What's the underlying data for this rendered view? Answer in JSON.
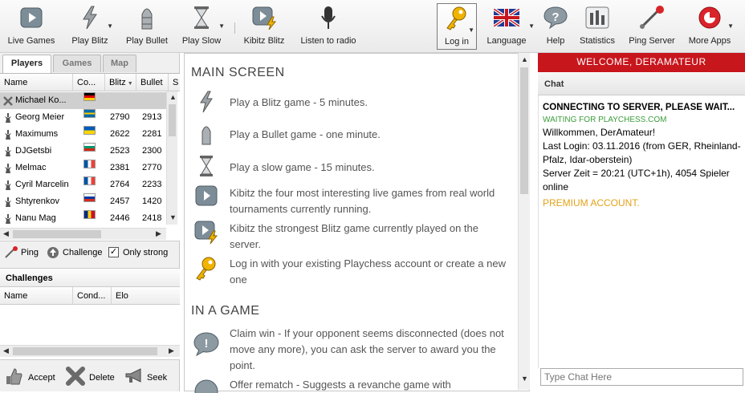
{
  "toolbar": {
    "live_games": "Live Games",
    "play_blitz": "Play Blitz",
    "play_bullet": "Play Bullet",
    "play_slow": "Play Slow",
    "kibitz_blitz": "Kibitz Blitz",
    "listen_radio": "Listen to radio",
    "log_in": "Log in",
    "language": "Language",
    "help": "Help",
    "statistics": "Statistics",
    "ping_server": "Ping Server",
    "more_apps": "More Apps"
  },
  "tabs": {
    "players": "Players",
    "games": "Games",
    "map": "Map"
  },
  "players_table": {
    "columns": [
      "Name",
      "Co...",
      "Blitz",
      "Bullet",
      "S"
    ],
    "rows": [
      {
        "name": "Michael Ko...",
        "flag": "de",
        "blitz": "",
        "bullet": ""
      },
      {
        "name": "Georg Meier",
        "flag": "se",
        "blitz": "2790",
        "bullet": "2913"
      },
      {
        "name": "Maximums",
        "flag": "ua",
        "blitz": "2622",
        "bullet": "2281"
      },
      {
        "name": "DJGetsbi",
        "flag": "bg",
        "blitz": "2523",
        "bullet": "2300"
      },
      {
        "name": "Melmac",
        "flag": "fr",
        "blitz": "2381",
        "bullet": "2770"
      },
      {
        "name": "Cyril Marcelin",
        "flag": "fr",
        "blitz": "2764",
        "bullet": "2233"
      },
      {
        "name": "Shtyrenkov",
        "flag": "ru",
        "blitz": "2457",
        "bullet": "1420"
      },
      {
        "name": "Nanu Mag",
        "flag": "ro",
        "blitz": "2446",
        "bullet": "2418"
      }
    ]
  },
  "player_actions": {
    "ping": "Ping",
    "challenge": "Challenge",
    "only_strong": "Only strong"
  },
  "challenges": {
    "title": "Challenges",
    "columns": [
      "Name",
      "Cond...",
      "Elo"
    ]
  },
  "challenge_actions": {
    "accept": "Accept",
    "delete": "Delete",
    "seek": "Seek"
  },
  "main": {
    "heading1": "MAIN SCREEN",
    "items": [
      "Play a Blitz game - 5 minutes.",
      "Play a Bullet game - one minute.",
      "Play a slow game - 15 minutes.",
      "Kibitz the four most interesting live games from real world tournaments currently running.",
      "Kibitz the strongest Blitz game currently played on the server.",
      "Log in with your existing Playchess account or create a new one"
    ],
    "heading2": "IN A GAME",
    "items2": [
      "Claim win - If your opponent seems disconnected (does not move any more), you can ask the server to award you the point.",
      "Offer rematch - Suggests a revanche game with"
    ]
  },
  "chat": {
    "welcome": "WELCOME, DERAMATEUR",
    "title": "Chat",
    "connecting": "CONNECTING TO SERVER, PLEASE WAIT...",
    "waiting": "WAITING FOR PLAYCHESS.COM",
    "line1": "Willkommen, DerAmateur!",
    "line2": "Last Login: 03.11.2016 (from GER, Rheinland-Pfalz, Idar-oberstein)",
    "line3": "Server Zeit = 20:21 (UTC+1h), 4054 Spieler online",
    "premium": "PREMIUM ACCOUNT.",
    "placeholder": "Type Chat Here"
  },
  "colors": {
    "accent_red": "#c8161d",
    "waiting_green": "#3a9d3a",
    "premium_orange": "#e3a21a"
  }
}
